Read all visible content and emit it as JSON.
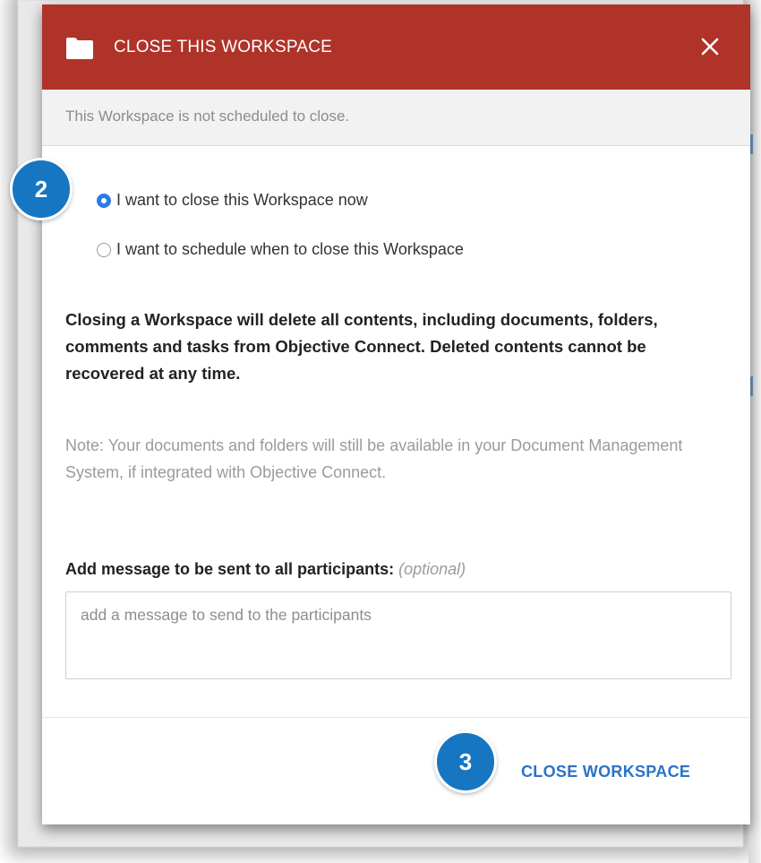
{
  "dialog": {
    "title": "CLOSE THIS WORKSPACE",
    "status": "This Workspace is not scheduled to close.",
    "options": [
      {
        "label": "I want to close this Workspace now",
        "checked": true
      },
      {
        "label": "I want to schedule when to close this Workspace",
        "checked": false
      }
    ],
    "warning": "Closing a Workspace will delete all contents, including documents, folders, comments and tasks from Objective Connect. Deleted contents cannot be recovered at any time.",
    "note": "Note: Your documents and folders will still be available in your Document Management System, if integrated with Objective Connect.",
    "message": {
      "label": "Add message to be sent to all participants:",
      "optional": "(optional)",
      "placeholder": "add a message to send to the participants",
      "value": ""
    },
    "action_label": "CLOSE WORKSPACE"
  },
  "annotations": {
    "step_2": "2",
    "step_3": "3"
  },
  "colors": {
    "header": "#b0332a",
    "accent_blue": "#2a73c9",
    "badge_blue": "#1676c1"
  },
  "icons": {
    "header_icon": "folder-icon",
    "close": "close-icon"
  }
}
